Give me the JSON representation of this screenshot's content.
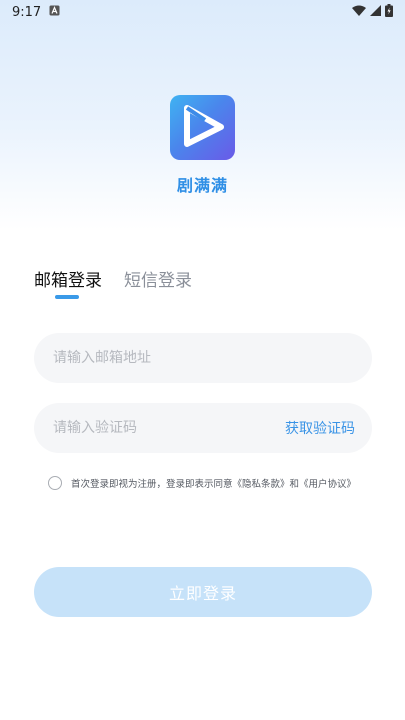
{
  "status_bar": {
    "time": "9:17",
    "icons": [
      "notification-a-icon",
      "wifi-icon",
      "cell-signal-icon",
      "battery-charging-icon"
    ]
  },
  "app": {
    "name": "剧满满",
    "logo_icon": "play-logo-icon"
  },
  "tabs": [
    {
      "label": "邮箱登录",
      "active": true
    },
    {
      "label": "短信登录",
      "active": false
    }
  ],
  "email_field": {
    "value": "",
    "placeholder": "请输入邮箱地址"
  },
  "code_field": {
    "value": "",
    "placeholder": "请输入验证码",
    "get_code_label": "获取验证码"
  },
  "agreement": {
    "checked": false,
    "text_prefix": "首次登录即视为注册，登录即表示同意",
    "privacy_link": "《隐私条款》",
    "conjunction": "和",
    "terms_link": "《用户协议》"
  },
  "login_button": {
    "label": "立即登录",
    "enabled": false
  },
  "colors": {
    "accent": "#3a94e6",
    "button_disabled": "#c6e2f9",
    "field_background": "#f5f6f8"
  }
}
